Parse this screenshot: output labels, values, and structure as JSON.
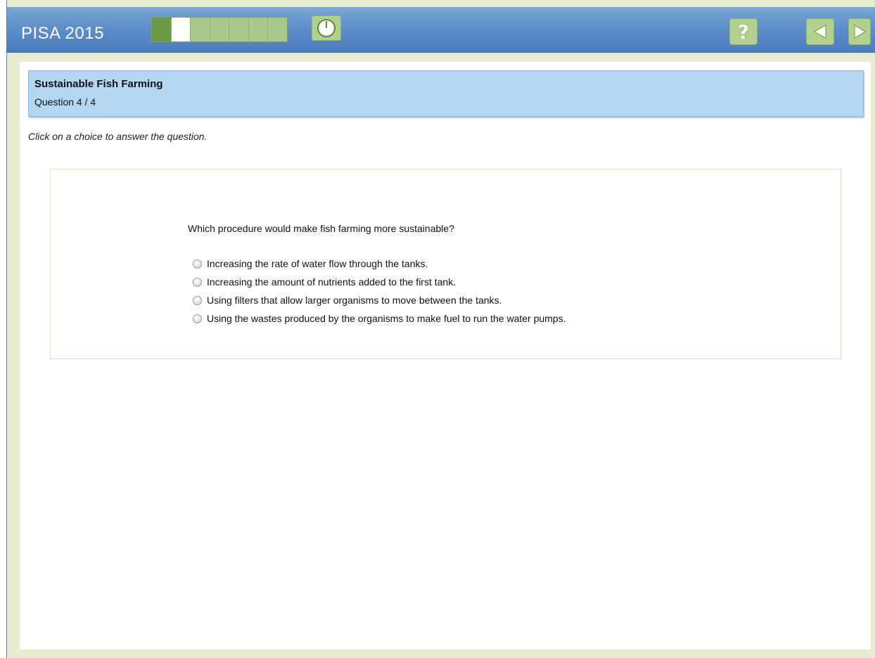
{
  "app": {
    "title": "PISA 2015"
  },
  "progress": {
    "total_segments": 7,
    "completed_segments": 1,
    "current_segment": 2
  },
  "toolbar": {
    "timer_icon": "clock-icon",
    "help_label": "?",
    "help_icon": "help-icon",
    "back_icon": "arrow-left-icon",
    "next_icon": "arrow-right-icon"
  },
  "header": {
    "unit_title": "Sustainable Fish Farming",
    "question_counter": "Question 4 / 4"
  },
  "instruction": "Click on a choice to answer the question.",
  "question": {
    "prompt": "Which procedure would make fish farming more sustainable?",
    "choices": [
      {
        "label": "Increasing the rate of water flow through the tanks.",
        "selected": false
      },
      {
        "label": "Increasing the amount of nutrients added to the first tank.",
        "selected": false
      },
      {
        "label": "Using filters that allow larger organisms to move between the tanks.",
        "selected": false
      },
      {
        "label": "Using the wastes produced by the organisms to make fuel to run the water pumps.",
        "selected": false
      }
    ]
  },
  "colors": {
    "topbar": "#5f8fca",
    "frame": "#e7edd0",
    "header_box": "#b3d6f1",
    "button_green": "#b2d08e",
    "progress_done": "#6a9a45"
  }
}
